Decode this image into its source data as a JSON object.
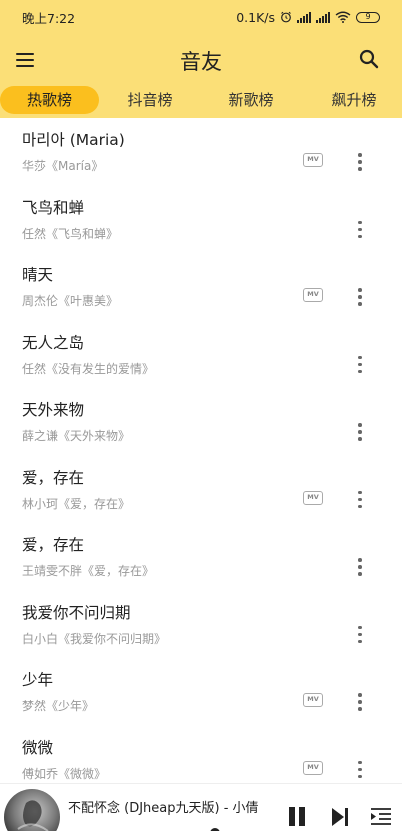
{
  "status_bar": {
    "time": "晚上7:22",
    "network_speed": "0.1K/s",
    "battery_level": "9"
  },
  "header": {
    "title": "音友",
    "menu_icon": "hamburger-menu-icon",
    "search_icon": "search-icon"
  },
  "tabs": [
    {
      "label": "热歌榜",
      "active": true
    },
    {
      "label": "抖音榜",
      "active": false
    },
    {
      "label": "新歌榜",
      "active": false
    },
    {
      "label": "飙升榜",
      "active": false
    }
  ],
  "songs": [
    {
      "title": "마리아 (Maria)",
      "subtitle": "华莎《María》",
      "has_mv": true
    },
    {
      "title": "飞鸟和蝉",
      "subtitle": "任然《飞鸟和蝉》",
      "has_mv": false
    },
    {
      "title": "晴天",
      "subtitle": "周杰伦《叶惠美》",
      "has_mv": true
    },
    {
      "title": "无人之岛",
      "subtitle": "任然《没有发生的爱情》",
      "has_mv": false
    },
    {
      "title": "天外来物",
      "subtitle": "薛之谦《天外来物》",
      "has_mv": false
    },
    {
      "title": "爱，存在",
      "subtitle": "林小珂《爱，存在》",
      "has_mv": true
    },
    {
      "title": "爱，存在",
      "subtitle": "王靖雯不胖《爱，存在》",
      "has_mv": false
    },
    {
      "title": "我爱你不问归期",
      "subtitle": "白小白《我爱你不问归期》",
      "has_mv": false
    },
    {
      "title": "少年",
      "subtitle": "梦然《少年》",
      "has_mv": true
    },
    {
      "title": "微微",
      "subtitle": "傅如乔《微微》",
      "has_mv": true
    }
  ],
  "mv_badge_label": "MV",
  "player": {
    "now_playing": "不配怀念 (DJheap九天版) - 小倩"
  },
  "colors": {
    "header_bg": "#fbdf77",
    "active_tab_bg": "#fbbf1e"
  }
}
